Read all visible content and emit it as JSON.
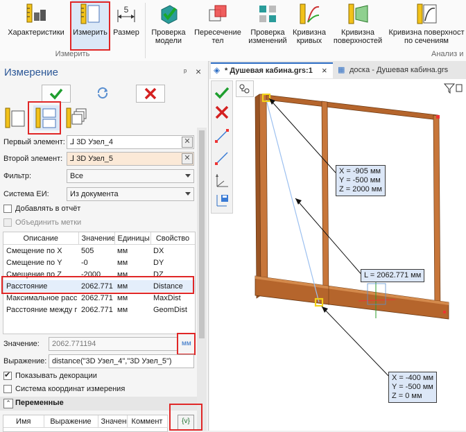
{
  "ribbon": {
    "buttons": [
      {
        "label": "Характеристики",
        "icon": "characteristics-icon"
      },
      {
        "label": "Измерить",
        "icon": "measure-ruler-icon"
      },
      {
        "label": "Размер",
        "icon": "dimension-icon"
      },
      {
        "label": "Проверка модели",
        "icon": "check-model-icon"
      },
      {
        "label": "Пересечение тел",
        "icon": "intersection-icon"
      },
      {
        "label": "Проверка изменений",
        "icon": "check-changes-icon"
      },
      {
        "label": "Кривизна кривых",
        "icon": "curve-curvature-icon"
      },
      {
        "label": "Кривизна поверхностей",
        "icon": "surface-curvature-icon"
      },
      {
        "label": "Кривизна поверхност по сечениям",
        "icon": "section-curvature-icon"
      }
    ],
    "group_measure": "Измерить",
    "group_analysis": "Анализ и"
  },
  "panel": {
    "title": "Измерение",
    "pin": "ᵖ",
    "close": "×",
    "first_element_label": "Первый элемент:",
    "first_element_value": "3D Узел_4",
    "second_element_label": "Второй элемент:",
    "second_element_value": "3D Узел_5",
    "filter_label": "Фильтр:",
    "filter_value": "Все",
    "units_system_label": "Система ЕИ:",
    "units_system_value": "Из документа",
    "add_to_report": "Добавлять в отчёт",
    "merge_marks": "Объединить метки",
    "table": {
      "headers": [
        "Описание",
        "Значение",
        "Единицы",
        "Свойство"
      ],
      "rows": [
        [
          "Смещение по X",
          "505",
          "мм",
          "DX"
        ],
        [
          "Смещение по Y",
          "-0",
          "мм",
          "DY"
        ],
        [
          "Смещение по Z",
          "-2000",
          "мм",
          "DZ"
        ],
        [
          "Расстояние",
          "2062.771",
          "мм",
          "Distance"
        ],
        [
          "Максимальное расс",
          "2062.771",
          "мм",
          "MaxDist"
        ],
        [
          "Расстояние между г",
          "2062.771",
          "мм",
          "GeomDist"
        ]
      ]
    },
    "value_label": "Значение:",
    "value_value": "2062.771194",
    "value_unit": "мм",
    "expression_label": "Выражение:",
    "expression_value": "distance(\"3D Узел_4\",\"3D Узел_5\")",
    "show_decorations": "Показывать декорации",
    "measure_coordinate_system": "Система координат измерения",
    "variables_title": "Переменные",
    "variables_headers": [
      "Имя",
      "Выражение",
      "Значени",
      "Коммент"
    ],
    "variables_button": "{v}"
  },
  "tabs": [
    {
      "label": "* Душевая кабина.grs:1",
      "close": "×"
    },
    {
      "label": "доска - Душевая кабина.grs"
    }
  ],
  "viewport": {
    "tip_point1": [
      "X = -905 мм",
      "Y = -500 мм",
      "Z = 2000 мм"
    ],
    "tip_distance": "L = 2062.771 мм",
    "tip_point2": [
      "X = -400 мм",
      "Y = -500 мм",
      "Z = 0 мм"
    ]
  },
  "colors": {
    "accent_red": "#e02626",
    "ok_green": "#1e9e2e",
    "cancel_red": "#d42020",
    "wood": "#b5652c",
    "tip_bg": "#dce7f7"
  }
}
